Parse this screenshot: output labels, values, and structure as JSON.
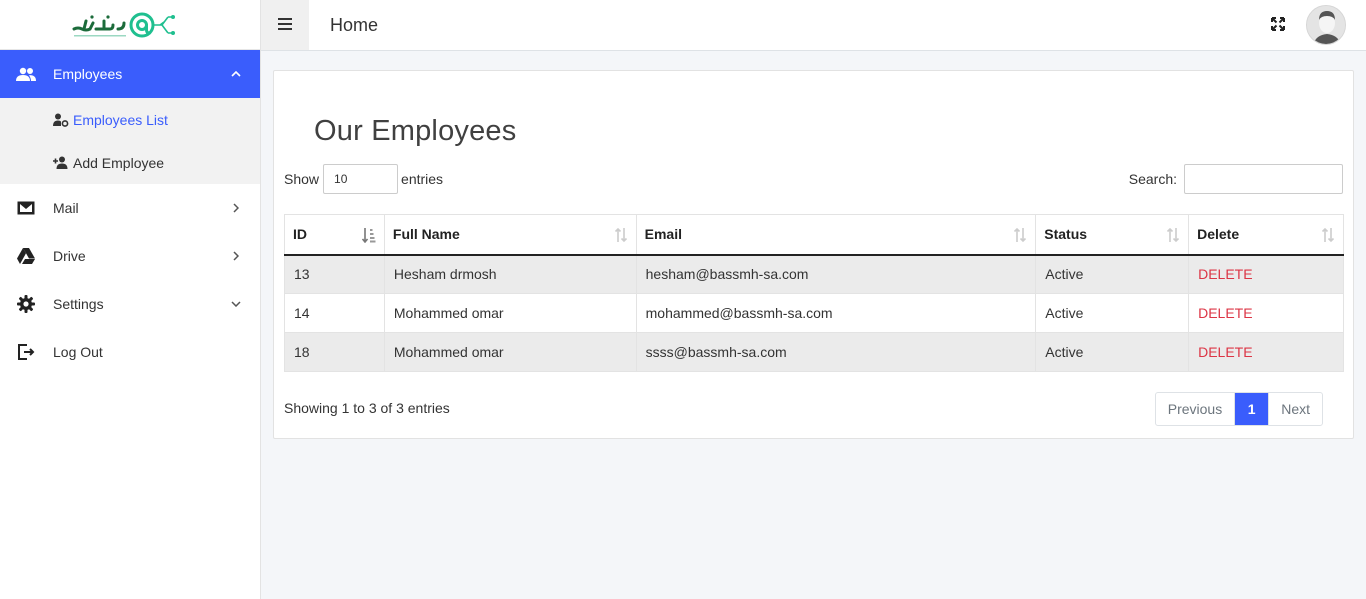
{
  "topbar": {
    "title": "Home"
  },
  "sidebar": {
    "items": [
      {
        "label": "Employees",
        "icon": "users-icon"
      },
      {
        "label": "Mail",
        "icon": "mail-icon"
      },
      {
        "label": "Drive",
        "icon": "drive-icon"
      },
      {
        "label": "Settings",
        "icon": "gear-icon"
      },
      {
        "label": "Log Out",
        "icon": "logout-icon"
      }
    ],
    "employees_sub": [
      {
        "label": "Employees List",
        "icon": "user-cog-icon"
      },
      {
        "label": "Add Employee",
        "icon": "user-plus-icon"
      }
    ]
  },
  "main": {
    "title": "Our Employees",
    "show_label": "Show",
    "entries_label": "entries",
    "page_length": "10",
    "search_label": "Search:",
    "search_value": "",
    "columns": [
      "ID",
      "Full Name",
      "Email",
      "Status",
      "Delete"
    ],
    "rows": [
      {
        "id": "13",
        "name": "Hesham drmosh",
        "email": "hesham@bassmh-sa.com",
        "status": "Active",
        "action": "DELETE"
      },
      {
        "id": "14",
        "name": "Mohammed omar",
        "email": "mohammed@bassmh-sa.com",
        "status": "Active",
        "action": "DELETE"
      },
      {
        "id": "18",
        "name": "Mohammed omar",
        "email": "ssss@bassmh-sa.com",
        "status": "Active",
        "action": "DELETE"
      }
    ],
    "info": "Showing 1 to 3 of 3 entries",
    "pagination": {
      "previous": "Previous",
      "current": "1",
      "next": "Next"
    }
  },
  "colors": {
    "accent": "#3a5dfc",
    "active_status": "#28a745",
    "delete": "#dc3545"
  }
}
